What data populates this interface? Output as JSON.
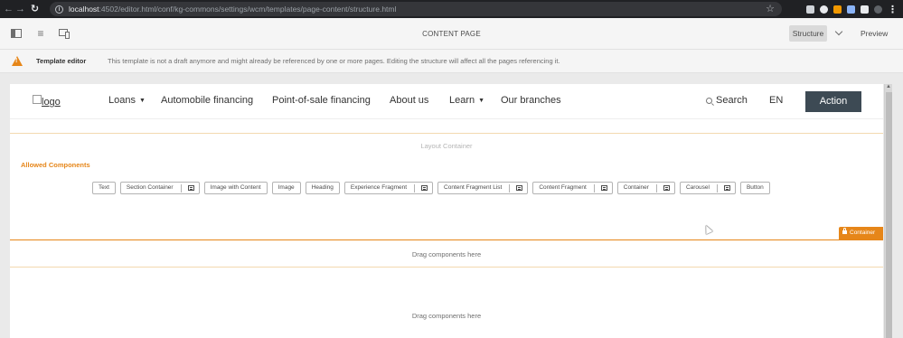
{
  "browser": {
    "url_host": "localhost",
    "url_rest": ":4502/editor.html/conf/kg-commons/settings/wcm/templates/page-content/structure.html"
  },
  "toolbar": {
    "title": "CONTENT PAGE",
    "structure_label": "Structure",
    "preview_label": "Preview"
  },
  "alert": {
    "title": "Template editor",
    "message": "This template is not a draft anymore and might already be referenced by one or more pages. Editing the structure will affect all the pages referencing it."
  },
  "site": {
    "logo_text": "logo",
    "nav": [
      {
        "label": "Loans",
        "has_dropdown": true
      },
      {
        "label": "Automobile financing",
        "has_dropdown": false
      },
      {
        "label": "Point-of-sale financing",
        "has_dropdown": false
      },
      {
        "label": "About us",
        "has_dropdown": false
      },
      {
        "label": "Learn",
        "has_dropdown": true
      },
      {
        "label": "Our branches",
        "has_dropdown": false
      }
    ],
    "search_label": "Search",
    "lang_label": "EN",
    "action_label": "Action"
  },
  "layout_container_label": "Layout Container",
  "allowed_components_label": "Allowed Components",
  "components": [
    {
      "label": "Text",
      "group": false
    },
    {
      "label": "Section Container",
      "group": true
    },
    {
      "label": "Image with Content",
      "group": false
    },
    {
      "label": "Image",
      "group": false
    },
    {
      "label": "Heading",
      "group": false
    },
    {
      "label": "Experience Fragment",
      "group": true
    },
    {
      "label": "Content Fragment List",
      "group": true
    },
    {
      "label": "Content Fragment",
      "group": true
    },
    {
      "label": "Container",
      "group": true
    },
    {
      "label": "Carousel",
      "group": true
    },
    {
      "label": "Button",
      "group": false
    }
  ],
  "container_tag": "Container",
  "drag_text_1": "Drag components here",
  "drag_text_2": "Drag components here",
  "colors": {
    "accent_orange": "#e68619",
    "action_button": "#3d4a54",
    "browser_bar": "#202124"
  }
}
